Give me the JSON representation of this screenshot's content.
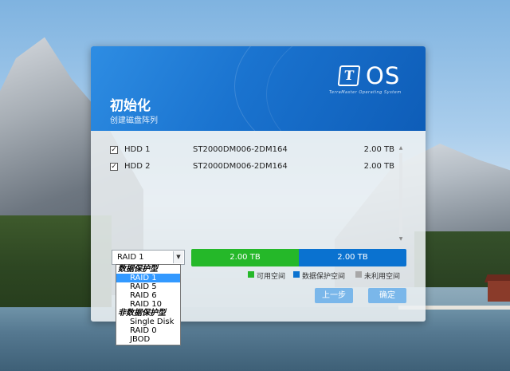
{
  "dialog": {
    "title": "初始化",
    "subtitle": "创建磁盘阵列",
    "logo": {
      "mark": "T",
      "text": "OS",
      "tagline": "TerraMaster Operating System"
    }
  },
  "disks": [
    {
      "checked": true,
      "name": "HDD 1",
      "model": "ST2000DM006-2DM164",
      "size": "2.00 TB"
    },
    {
      "checked": true,
      "name": "HDD 2",
      "model": "ST2000DM006-2DM164",
      "size": "2.00 TB"
    }
  ],
  "raid_select": {
    "value": "RAID 1"
  },
  "dropdown": {
    "items": [
      {
        "type": "group",
        "label": "数据保护型"
      },
      {
        "type": "option",
        "label": "RAID 1",
        "selected": true
      },
      {
        "type": "option",
        "label": "RAID 5"
      },
      {
        "type": "option",
        "label": "RAID 6"
      },
      {
        "type": "option",
        "label": "RAID 10"
      },
      {
        "type": "group",
        "label": "非数据保护型"
      },
      {
        "type": "option",
        "label": "Single Disk"
      },
      {
        "type": "option",
        "label": "RAID 0"
      },
      {
        "type": "option",
        "label": "JBOD"
      }
    ]
  },
  "capacity": {
    "available": "2.00 TB",
    "protection": "2.00 TB",
    "available_fraction": 0.5,
    "protection_fraction": 0.5
  },
  "legend": {
    "available": "可用空间",
    "protection": "数据保护空间",
    "unused": "未利用空间"
  },
  "buttons": {
    "back": "上一步",
    "confirm": "确定"
  },
  "colors": {
    "available": "#25b829",
    "protection": "#0a72d0",
    "unused": "#a7a7a7",
    "header": "#1a73cf",
    "button": "#7ab7ea"
  }
}
